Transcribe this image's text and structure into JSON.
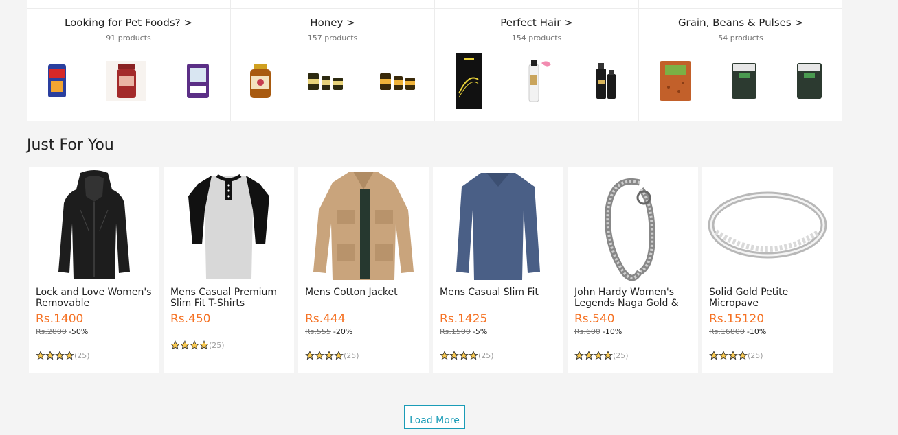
{
  "categories": [
    {
      "title": "Looking for Pet Foods? >",
      "count": "91 products"
    },
    {
      "title": "Honey >",
      "count": "157 products"
    },
    {
      "title": "Perfect Hair >",
      "count": "154 products"
    },
    {
      "title": "Grain, Beans & Pulses >",
      "count": "54 products"
    }
  ],
  "section_title": "Just For You",
  "products": [
    {
      "name": "Lock and Love Women's Removable",
      "price": "Rs.1400",
      "old_price": "Rs.2800",
      "discount": "-50%",
      "reviews": "(25)"
    },
    {
      "name": "Mens Casual Premium Slim Fit T-Shirts",
      "price": "Rs.450",
      "old_price": "",
      "discount": "",
      "reviews": "(25)"
    },
    {
      "name": "Mens Cotton Jacket",
      "price": "Rs.444",
      "old_price": "Rs.555",
      "discount": "-20%",
      "reviews": "(25)"
    },
    {
      "name": "Mens Casual Slim Fit",
      "price": "Rs.1425",
      "old_price": "Rs.1500",
      "discount": "-5%",
      "reviews": "(25)"
    },
    {
      "name": "John Hardy Women's Legends Naga Gold &",
      "price": "Rs.540",
      "old_price": "Rs.600",
      "discount": "-10%",
      "reviews": "(25)"
    },
    {
      "name": "Solid Gold Petite Micropave",
      "price": "Rs.15120",
      "old_price": "Rs.16800",
      "discount": "-10%",
      "reviews": "(25)"
    }
  ],
  "load_more": "Load More",
  "colors": {
    "price": "#f57224",
    "accent": "#1a9cb7",
    "star": "#faca51"
  }
}
